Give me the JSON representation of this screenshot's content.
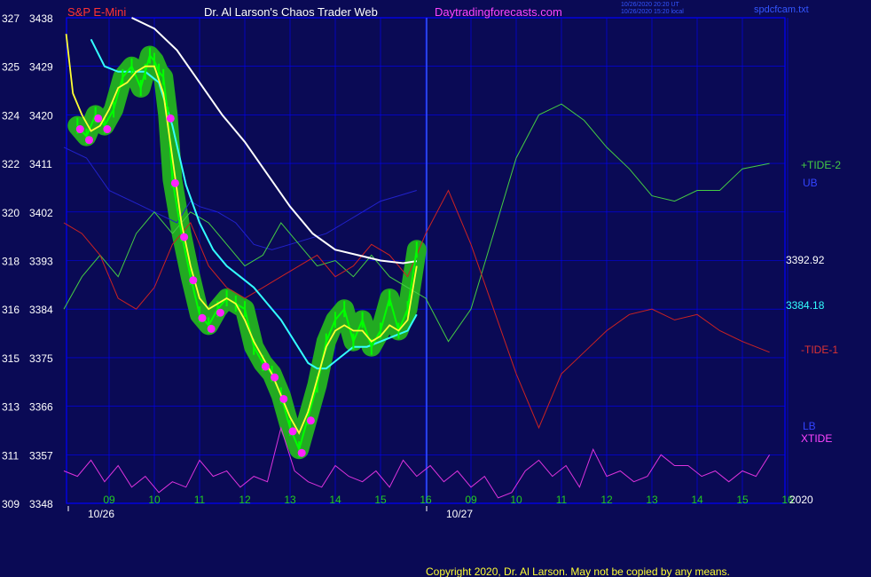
{
  "header": {
    "symbol": "S&P E-Mini",
    "title": "Dr. Al Larson's Chaos Trader Web",
    "site": "Daytradingforecasts.com",
    "timestamp_ut": "10/26/2020 20:20 UT",
    "timestamp_local": "10/26/2020 15:20 local",
    "filename": "spdcfcam.txt"
  },
  "copyright": "Copyright 2020, Dr. Al Larson. May not be copied by any means.",
  "year_label": "2020",
  "colors": {
    "background": "#0a0a55",
    "grid": "#0000ff",
    "price_bars": "#00ff00",
    "price_halo": "#22aa22",
    "yellow_avg": "#ffff33",
    "cyan_avg": "#33ffff",
    "white_avg": "#ffffff",
    "upper_band": "#2222cc",
    "tide2": "#44cc44",
    "tide1": "#cc2222",
    "xtide": "#dd33dd",
    "markers": "#ff22ff"
  },
  "chart_data": {
    "type": "line",
    "y_left_labels": [
      "327",
      "325",
      "324",
      "322",
      "320",
      "318",
      "316",
      "315",
      "313",
      "311",
      "309"
    ],
    "y_right_labels": [
      "3438",
      "3429",
      "3420",
      "3411",
      "3402",
      "3393",
      "3384",
      "3375",
      "3366",
      "3357",
      "3348"
    ],
    "ylim": [
      3348,
      3438
    ],
    "x_hour_labels": [
      "09",
      "10",
      "11",
      "12",
      "13",
      "14",
      "15",
      "16",
      "09",
      "10",
      "11",
      "12",
      "13",
      "14",
      "15",
      "16"
    ],
    "x_date_labels": [
      "10/26",
      "10/27"
    ],
    "price_readout": "3392.92",
    "cyan_readout": "3384.18",
    "legend": [
      "+TIDE-2",
      "UB",
      "-TIDE-1",
      "LB",
      "XTIDE"
    ],
    "series": [
      {
        "name": "price",
        "hours": [
          8.3,
          8.5,
          8.7,
          8.9,
          9.1,
          9.3,
          9.5,
          9.7,
          9.8,
          9.9,
          10.0,
          10.1,
          10.2,
          10.3,
          10.4,
          10.6,
          10.8,
          11.0,
          11.2,
          11.4,
          11.6,
          11.8,
          12.0,
          12.2,
          12.4,
          12.6,
          12.8,
          13.0,
          13.2,
          13.4,
          13.6,
          13.8,
          14.0,
          14.2,
          14.4,
          14.6,
          14.8,
          15.0,
          15.2,
          15.4,
          15.6,
          15.8
        ],
        "values": [
          3418,
          3416,
          3420,
          3418,
          3421,
          3427,
          3429,
          3425,
          3428,
          3431,
          3430,
          3428,
          3427,
          3420,
          3408,
          3398,
          3390,
          3383,
          3381,
          3384,
          3386,
          3385,
          3384,
          3377,
          3374,
          3372,
          3368,
          3362,
          3358,
          3364,
          3370,
          3378,
          3382,
          3384,
          3378,
          3382,
          3377,
          3380,
          3386,
          3380,
          3384,
          3395
        ]
      },
      {
        "name": "yellow",
        "hours": [
          8.05,
          8.2,
          8.4,
          8.6,
          8.8,
          9.0,
          9.2,
          9.4,
          9.6,
          9.8,
          10.0,
          10.2,
          10.4,
          10.6,
          10.8,
          11.0,
          11.2,
          11.4,
          11.6,
          11.8,
          12.0,
          12.2,
          12.4,
          12.6,
          12.8,
          13.0,
          13.2,
          13.4,
          13.6,
          13.8,
          14.0,
          14.2,
          14.4,
          14.6,
          14.8,
          15.0,
          15.2,
          15.4,
          15.6,
          15.8
        ],
        "values": [
          3435,
          3424,
          3420,
          3417,
          3418,
          3421,
          3425,
          3426,
          3428,
          3429,
          3429,
          3424,
          3412,
          3400,
          3392,
          3386,
          3384,
          3385,
          3386,
          3385,
          3382,
          3378,
          3375,
          3372,
          3368,
          3364,
          3361,
          3365,
          3371,
          3377,
          3380,
          3381,
          3380,
          3380,
          3378,
          3379,
          3381,
          3380,
          3382,
          3392
        ]
      },
      {
        "name": "cyan",
        "hours": [
          8.6,
          8.9,
          9.2,
          9.5,
          9.8,
          10.1,
          10.4,
          10.7,
          11.0,
          11.3,
          11.6,
          11.9,
          12.2,
          12.5,
          12.8,
          13.1,
          13.4,
          13.6,
          13.8,
          14.1,
          14.4,
          14.7,
          15.0,
          15.3,
          15.6,
          15.8
        ],
        "values": [
          3434,
          3429,
          3428,
          3428,
          3428,
          3426,
          3418,
          3407,
          3400,
          3395,
          3392,
          3390,
          3388,
          3385,
          3382,
          3378,
          3374,
          3373,
          3373,
          3375,
          3377,
          3377,
          3378,
          3379,
          3380,
          3383
        ]
      },
      {
        "name": "white",
        "hours": [
          9.5,
          10.0,
          10.5,
          11.0,
          11.5,
          12.0,
          12.5,
          13.0,
          13.5,
          14.0,
          14.5,
          15.0,
          15.5,
          15.8
        ],
        "values": [
          3438,
          3436,
          3432,
          3426,
          3420,
          3415,
          3409,
          3403,
          3398,
          3395,
          3394,
          3393,
          3392.5,
          3392.9
        ]
      },
      {
        "name": "+TIDE-2",
        "hours": [
          8.0,
          8.4,
          8.8,
          9.2,
          9.6,
          10.0,
          10.4,
          10.8,
          11.2,
          11.6,
          12.0,
          12.4,
          12.8,
          13.2,
          13.6,
          14.0,
          14.4,
          14.8,
          15.2,
          15.6,
          16.0,
          16.5,
          17.0,
          17.5,
          18.0,
          18.5,
          19.0,
          19.5,
          20.0,
          20.5,
          21.0,
          21.5,
          22.0,
          22.5,
          23.0,
          23.6
        ],
        "values": [
          3384,
          3390,
          3394,
          3390,
          3398,
          3402,
          3398,
          3402,
          3400,
          3396,
          3392,
          3394,
          3400,
          3396,
          3392,
          3393,
          3390,
          3394,
          3390,
          3388,
          3386,
          3378,
          3384,
          3398,
          3412,
          3420,
          3422,
          3419,
          3414,
          3410,
          3405,
          3404,
          3406,
          3406,
          3410,
          3411
        ]
      },
      {
        "name": "-TIDE-1",
        "hours": [
          8.0,
          8.4,
          8.8,
          9.2,
          9.6,
          10.0,
          10.4,
          10.8,
          11.2,
          11.6,
          12.0,
          12.4,
          12.8,
          13.2,
          13.6,
          14.0,
          14.4,
          14.8,
          15.2,
          15.6,
          16.0,
          16.5,
          17.0,
          17.5,
          18.0,
          18.5,
          19.0,
          19.5,
          20.0,
          20.5,
          21.0,
          21.5,
          22.0,
          22.5,
          23.0,
          23.6
        ],
        "values": [
          3400,
          3398,
          3394,
          3386,
          3384,
          3388,
          3396,
          3400,
          3392,
          3388,
          3386,
          3388,
          3390,
          3392,
          3394,
          3390,
          3392,
          3396,
          3394,
          3390,
          3398,
          3406,
          3396,
          3384,
          3372,
          3362,
          3372,
          3376,
          3380,
          3383,
          3384,
          3382,
          3383,
          3380,
          3378,
          3376
        ]
      },
      {
        "name": "UB",
        "hours": [
          8.0,
          8.5,
          9.0,
          9.5,
          10.0,
          10.5,
          10.8,
          11.0,
          11.4,
          11.8,
          12.2,
          12.6,
          13.0,
          13.4,
          13.8,
          14.2,
          14.6,
          15.0,
          15.4,
          15.8
        ],
        "values": [
          3414,
          3412,
          3406,
          3404,
          3402,
          3400,
          3404,
          3403,
          3402,
          3400,
          3396,
          3395,
          3396,
          3397,
          3398,
          3400,
          3402,
          3404,
          3405,
          3406
        ]
      },
      {
        "name": "XTIDE",
        "hours": [
          8.0,
          8.3,
          8.6,
          8.9,
          9.2,
          9.5,
          9.8,
          10.1,
          10.4,
          10.7,
          11.0,
          11.3,
          11.6,
          11.9,
          12.2,
          12.5,
          12.8,
          13.1,
          13.4,
          13.7,
          14.0,
          14.3,
          14.6,
          14.9,
          15.2,
          15.5,
          15.8,
          16.1,
          16.4,
          16.7,
          17.0,
          17.3,
          17.6,
          17.9,
          18.2,
          18.5,
          18.8,
          19.1,
          19.4,
          19.7,
          20.0,
          20.3,
          20.6,
          20.9,
          21.2,
          21.5,
          21.8,
          22.1,
          22.4,
          22.7,
          23.0,
          23.3,
          23.6
        ],
        "values": [
          3354,
          3353,
          3356,
          3352,
          3355,
          3351,
          3353,
          3350,
          3352,
          3351,
          3356,
          3353,
          3354,
          3351,
          3353,
          3352,
          3362,
          3354,
          3352,
          3351,
          3355,
          3353,
          3352,
          3354,
          3351,
          3356,
          3353,
          3355,
          3352,
          3354,
          3351,
          3353,
          3349,
          3350,
          3354,
          3356,
          3353,
          3355,
          3351,
          3358,
          3353,
          3354,
          3352,
          3353,
          3357,
          3355,
          3355,
          3353,
          3354,
          3352,
          3354,
          3353,
          3357
        ]
      }
    ]
  }
}
